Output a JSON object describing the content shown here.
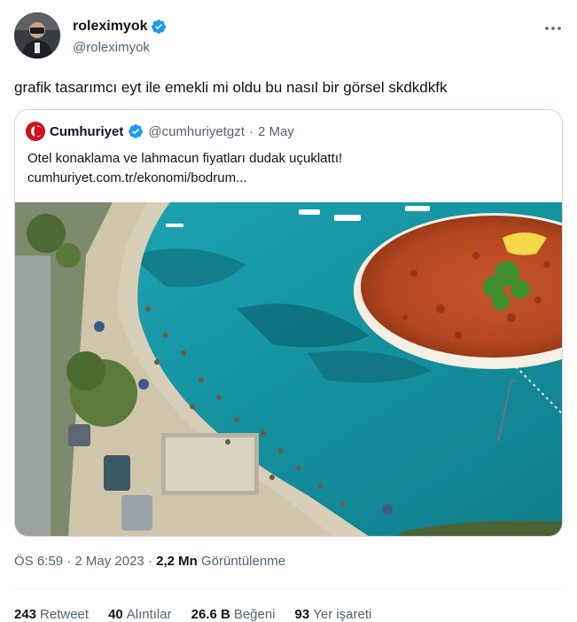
{
  "author": {
    "display_name": "roleximyok",
    "handle": "@roleximyok",
    "avatar_icon": "user-avatar-icon",
    "verified_icon": "verified-badge-icon"
  },
  "more_icon": "more-options-icon",
  "tweet": {
    "text": "grafik tasarımcı eyt ile emekli mi oldu bu nasıl bir görsel skdkdkfk"
  },
  "quote": {
    "logo_icon": "cumhuriyet-logo-icon",
    "name": "Cumhuriyet",
    "handle": "@cumhuriyetgzt",
    "separator": "·",
    "date": "2 May",
    "text": "Otel konaklama ve lahmacun fiyatları dudak uçuklattı!",
    "link": "cumhuriyet.com.tr/ekonomi/bodrum..."
  },
  "meta": {
    "time": "ÖS 6:59",
    "separator": "·",
    "date": "2 May 2023",
    "views_count": "2,2 Mn",
    "views_label": "Görüntülenme"
  },
  "stats": [
    {
      "count": "243",
      "label": "Retweet"
    },
    {
      "count": "40",
      "label": "Alıntılar"
    },
    {
      "count": "26.6 B",
      "label": "Beğeni"
    },
    {
      "count": "93",
      "label": "Yer işareti"
    }
  ],
  "colors": {
    "verified": "#1d9bf0",
    "secondary_text": "#536471",
    "border": "#cfd9de",
    "cumhuriyet_red": "#d0121b"
  }
}
